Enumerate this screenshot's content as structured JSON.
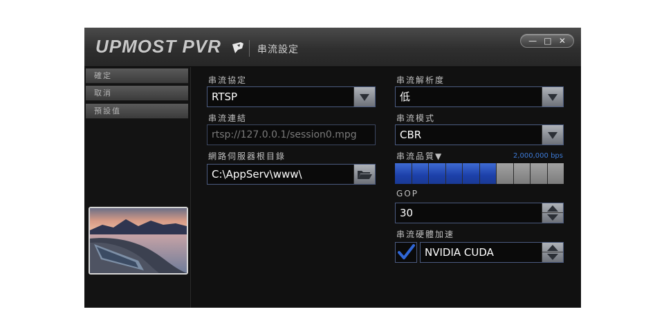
{
  "app": {
    "brand": "UPMOST PVR",
    "window_title": "串流設定",
    "controls": {
      "minimize": "—",
      "maximize": "□",
      "close": "✕"
    }
  },
  "sidebar": {
    "items": [
      {
        "label": "確定"
      },
      {
        "label": "取消"
      },
      {
        "label": "預設值"
      }
    ]
  },
  "left_panel": {
    "protocol_label": "串流協定",
    "protocol_value": "RTSP",
    "link_label": "串流連結",
    "link_value": "rtsp://127.0.0.1/session0.mpg",
    "root_label": "網路伺服器根目錄",
    "root_value": "C:\\AppServ\\www\\"
  },
  "right_panel": {
    "resolution_label": "串流解析度",
    "resolution_value": "低",
    "mode_label": "串流模式",
    "mode_value": "CBR",
    "quality_label": "串流品質▼",
    "quality_bps": "2,000,000 bps",
    "quality_level": {
      "filled": 6,
      "total": 10
    },
    "gop_label": "GOP",
    "gop_value": "30",
    "hw_label": "串流硬體加速",
    "hw_checked": true,
    "hw_value": "NVIDIA CUDA"
  },
  "colors": {
    "accent_blue": "#1c40a9",
    "bps_text": "#3d7bd8",
    "field_border": "#4b5b80"
  }
}
